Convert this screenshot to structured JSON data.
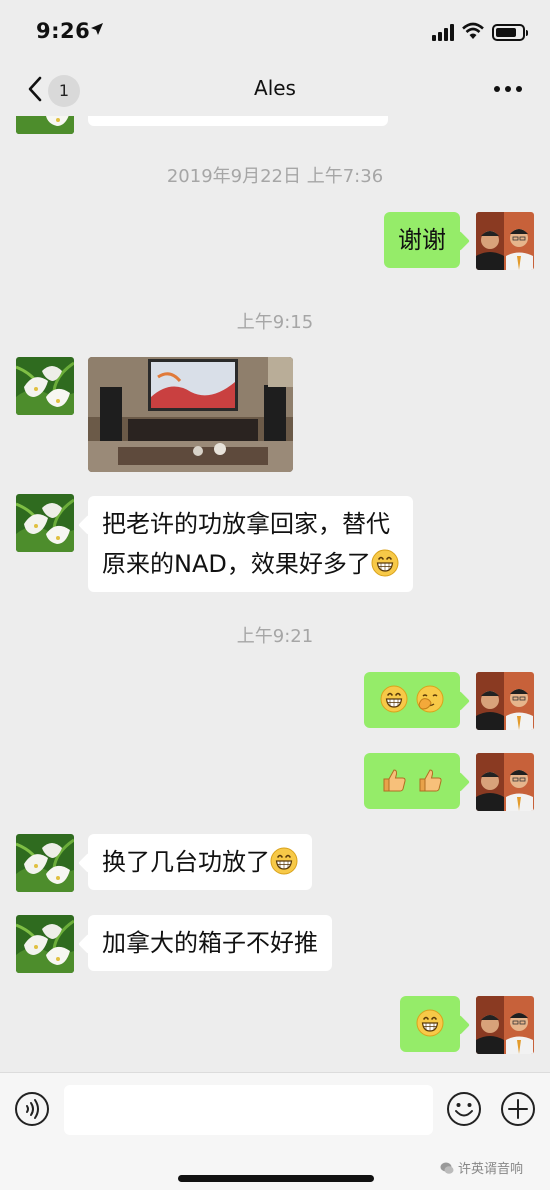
{
  "status_bar": {
    "time": "9:26"
  },
  "nav": {
    "unread_count": "1",
    "title": "Ales"
  },
  "chat": {
    "timestamps": [
      "2019年9月22日 上午7:36",
      "上午9:15",
      "上午9:21"
    ],
    "messages": [
      {
        "from": "me",
        "text": "谢谢"
      },
      {
        "from": "other",
        "type": "image"
      },
      {
        "from": "other",
        "lines": [
          "把老许的功放拿回家，替代",
          "原来的NAD，效果好多了"
        ],
        "emoji": "grin"
      },
      {
        "from": "me",
        "emojis": [
          "grin",
          "facepalm"
        ]
      },
      {
        "from": "me",
        "emojis": [
          "thumbs-up",
          "thumbs-up"
        ]
      },
      {
        "from": "other",
        "text": "换了几台功放了",
        "emoji": "grin"
      },
      {
        "from": "other",
        "text": "加拿大的箱子不好推"
      },
      {
        "from": "me",
        "emojis": [
          "grin"
        ]
      }
    ]
  },
  "watermark": "许英谞音响",
  "colors": {
    "outgoing_bubble": "#95ec69",
    "incoming_bubble": "#ffffff",
    "background": "#ededed"
  }
}
